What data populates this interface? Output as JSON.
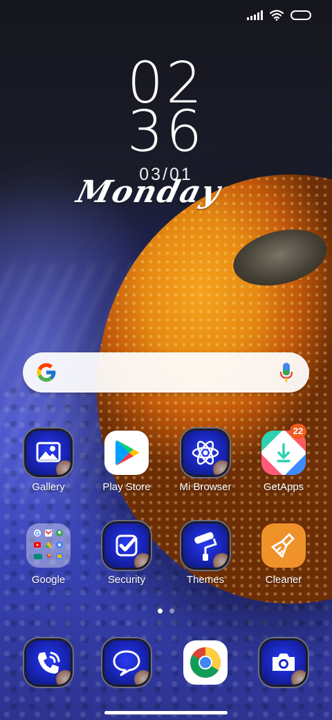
{
  "clock": {
    "hours": "02",
    "minutes": "36",
    "date": "03/01",
    "weekday": "Monday"
  },
  "status_bar": {
    "icons": [
      "signal-icon",
      "wifi-icon",
      "battery-icon"
    ]
  },
  "search": {
    "logo": "google-logo-icon",
    "mic": "mic-icon"
  },
  "apps": [
    {
      "label": "Gallery",
      "icon": "gallery-icon"
    },
    {
      "label": "Play Store",
      "icon": "play-store-icon"
    },
    {
      "label": "Mi Browser",
      "icon": "atom-icon"
    },
    {
      "label": "GetApps",
      "icon": "getapps-icon",
      "badge": "22"
    },
    {
      "label": "Google",
      "icon": "google-folder-icon"
    },
    {
      "label": "Security",
      "icon": "checkmark-icon"
    },
    {
      "label": "Themes",
      "icon": "paint-roller-icon"
    },
    {
      "label": "Cleaner",
      "icon": "broom-icon"
    }
  ],
  "dock": [
    {
      "icon": "phone-icon"
    },
    {
      "icon": "message-icon"
    },
    {
      "icon": "chrome-icon"
    },
    {
      "icon": "camera-icon"
    }
  ],
  "pages": {
    "count": 2,
    "active": 1
  },
  "colors": {
    "accent_blue": "#1a27c0",
    "badge_orange": "#f25b1f",
    "cleaner_orange": "#f0922a"
  }
}
